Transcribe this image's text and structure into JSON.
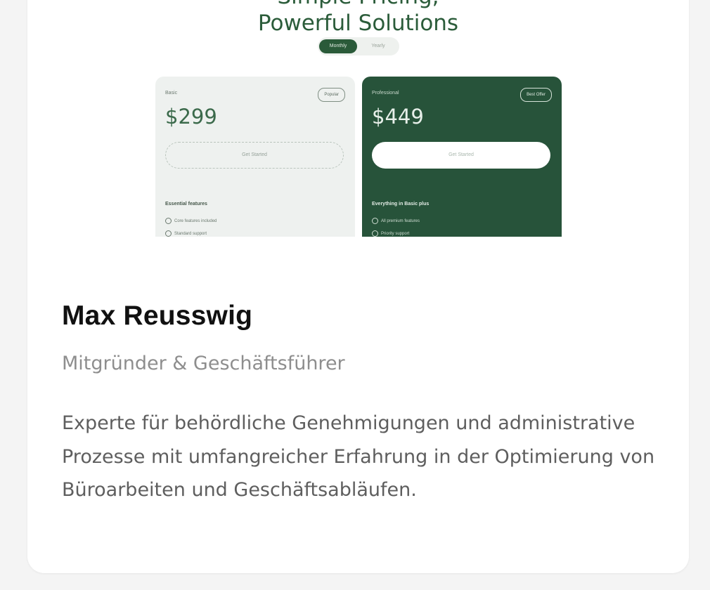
{
  "preview": {
    "headline_line1": "Simple Pricing,",
    "headline_line2": "Powerful Solutions",
    "toggle_active": "Monthly",
    "toggle_inactive": "Yearly",
    "plans": [
      {
        "name": "Basic",
        "badge": "Popular",
        "price": "$299",
        "button": "Get Started",
        "features_title": "Essential features",
        "features": [
          "Core features included",
          "Standard support"
        ]
      },
      {
        "name": "Professional",
        "badge": "Best Offer",
        "price": "$449",
        "button": "Get Started",
        "features_title": "Everything in Basic plus",
        "features": [
          "All premium features",
          "Priority support"
        ]
      }
    ],
    "colors": {
      "brand_green": "#27533a",
      "light_card": "#eef1ef"
    }
  },
  "profile": {
    "name": "Max Reusswig",
    "role": "Mitgründer & Geschäftsführer",
    "bio": "Experte für behördliche Genehmigungen und administrative Prozesse mit umfangreicher Erfahrung in der Optimierung von Büroarbeiten und Geschäftsabläufen."
  }
}
